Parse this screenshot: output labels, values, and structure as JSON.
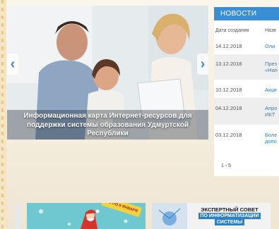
{
  "slider": {
    "caption": "Информационная карта Интернет-ресурсов для поддержки системы образования Удмуртской Республики",
    "prev_icon": "chevron-left-icon",
    "next_icon": "chevron-right-icon"
  },
  "news": {
    "title": "НОВОСТИ",
    "col_date": "Дата создания",
    "col_name": "Назв",
    "rows": [
      {
        "date": "14.12.2018",
        "title_lines": [
          "Оли"
        ]
      },
      {
        "date": "13.12.2018",
        "title_lines": [
          "През",
          "«Нап"
        ]
      },
      {
        "date": "10.12.2018",
        "title_lines": [
          "Акци"
        ]
      },
      {
        "date": "04.12.2018",
        "title_lines": [
          "Апро",
          "ИКТ"
        ]
      },
      {
        "date": "03.12.2018",
        "title_lines": [
          "Боле",
          "допо"
        ]
      }
    ],
    "pager": "1 - 5"
  },
  "banners": {
    "winter_tag": "С 3 ПО 9 ЯНВАРЯ",
    "expert_line1": "ЭКСПЕРТНЫЙ СОВЕТ",
    "expert_line2": "ПО ИНФОРМАТИЗАЦИИ",
    "expert_line3": "СИСТЕМЫ"
  },
  "colors": {
    "news_header": "#3a8ed3",
    "link": "#2f7fc4",
    "page_bg": "#f6efe2"
  }
}
